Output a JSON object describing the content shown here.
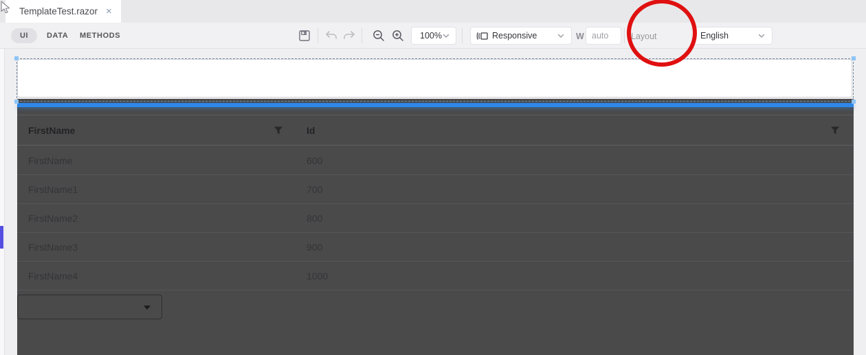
{
  "tabbar": {
    "active_tab": "TemplateTest.razor",
    "close_icon": "×"
  },
  "toolbar": {
    "mode_tabs": [
      {
        "label": "UI",
        "active": true
      },
      {
        "label": "DATA",
        "active": false
      },
      {
        "label": "METHODS",
        "active": false
      }
    ],
    "zoom_select": {
      "value": "100%"
    },
    "device_select": {
      "value": "Responsive"
    },
    "width_field": {
      "label": "W",
      "value": "auto"
    },
    "layout_toggle": {
      "label": "Layout",
      "state": "off"
    },
    "language_select": {
      "value": "English"
    }
  },
  "annotation": {
    "type": "hand-drawn-circle",
    "color": "#e01010"
  },
  "preview": {
    "grid": {
      "columns": [
        "FirstName",
        "Id"
      ],
      "rows": [
        {
          "first_name": "FirstName",
          "id": "600"
        },
        {
          "first_name": "FirstName1",
          "id": "700"
        },
        {
          "first_name": "FirstName2",
          "id": "800"
        },
        {
          "first_name": "FirstName3",
          "id": "900"
        },
        {
          "first_name": "FirstName4",
          "id": "1000"
        }
      ],
      "pager": {
        "page_size_value": ""
      }
    }
  },
  "colors": {
    "insert_indicator_blue": "#2e87e9",
    "left_indicator_blue": "#554ee2",
    "annotation_red": "#e01010",
    "dim_background": "#4a4a4b"
  }
}
